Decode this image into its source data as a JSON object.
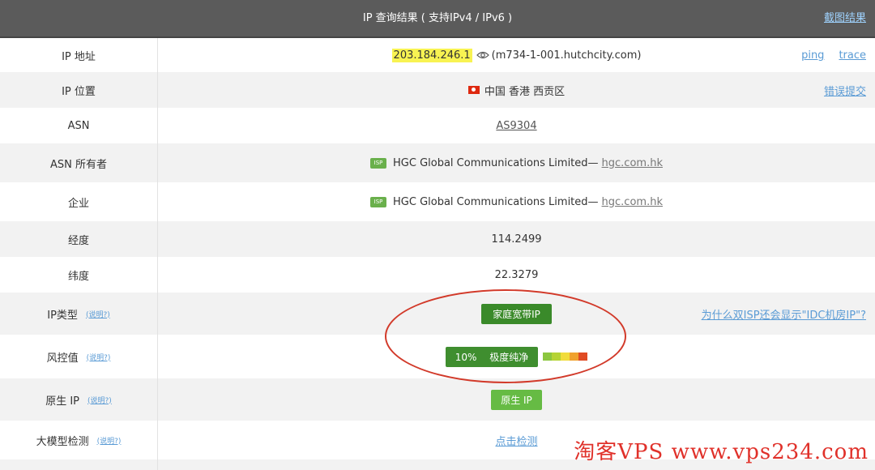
{
  "header": {
    "title": "IP 查询结果 ( 支持IPv4 / IPv6 )",
    "screenshot_link": "截图结果"
  },
  "rows": {
    "ip": {
      "label": "IP 地址",
      "value": "203.184.246.1",
      "hostname": "(m734-1-001.hutchcity.com)",
      "ping": "ping",
      "trace": "trace"
    },
    "location": {
      "label": "IP 位置",
      "value": "中国 香港 西贡区",
      "report_link": "错误提交"
    },
    "asn": {
      "label": "ASN",
      "value": "AS9304"
    },
    "asn_owner": {
      "label": "ASN 所有者",
      "badge": "ISP",
      "value": "HGC Global Communications Limited—",
      "domain": "hgc.com.hk"
    },
    "company": {
      "label": "企业",
      "badge": "ISP",
      "value": "HGC Global Communications Limited—",
      "domain": "hgc.com.hk"
    },
    "longitude": {
      "label": "经度",
      "value": "114.2499"
    },
    "latitude": {
      "label": "纬度",
      "value": "22.3279"
    },
    "ip_type": {
      "label": "IP类型",
      "help": "(说明?)",
      "value": "家庭宽带IP",
      "side_link": "为什么双ISP还会显示\"IDC机房IP\"?"
    },
    "risk": {
      "label": "风控值",
      "help": "(说明?)",
      "percent": "10%",
      "text": "极度纯净"
    },
    "native_ip": {
      "label": "原生 IP",
      "help": "(说明?)",
      "value": "原生 IP"
    },
    "llm_check": {
      "label": "大模型检测",
      "help": "(说明?)",
      "value": "点击检测"
    }
  },
  "colors": {
    "header_bg": "#5b5b5b",
    "highlight": "#f8f352",
    "green_dark": "#3a8a2a",
    "green_light": "#66bb44",
    "link_blue": "#5a9bd5",
    "annotation_red": "#d23a2a"
  },
  "risk_bar_colors": [
    "#8cc63f",
    "#b5d335",
    "#f1dc3c",
    "#f0a22e",
    "#e04b24"
  ],
  "watermark": "淘客VPS www.vps234.com"
}
